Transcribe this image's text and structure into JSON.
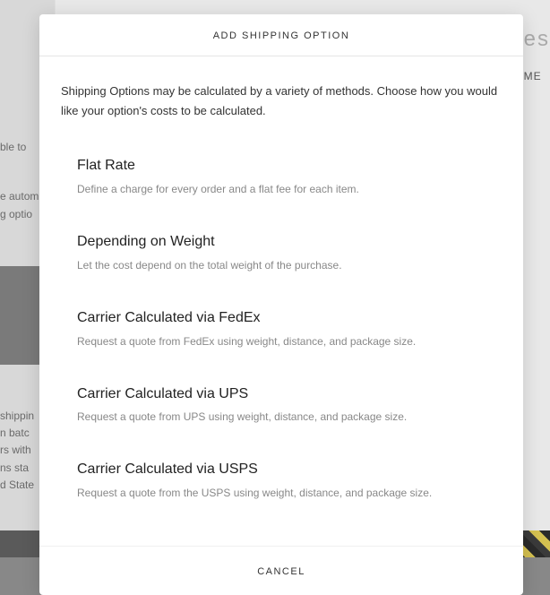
{
  "modal": {
    "title": "ADD SHIPPING OPTION",
    "intro": "Shipping Options may be calculated by a variety of methods. Choose how you would like your option's costs to be calculated.",
    "options": [
      {
        "title": "Flat Rate",
        "desc": "Define a charge for every order and a flat fee for each item."
      },
      {
        "title": "Depending on Weight",
        "desc": "Let the cost depend on the total weight of the purchase."
      },
      {
        "title": "Carrier Calculated via FedEx",
        "desc": "Request a quote from FedEx using weight, distance, and package size."
      },
      {
        "title": "Carrier Calculated via UPS",
        "desc": "Request a quote from UPS using weight, distance, and package size."
      },
      {
        "title": "Carrier Calculated via USPS",
        "desc": "Request a quote from the USPS using weight, distance, and package size."
      }
    ],
    "cancel": "CANCEL"
  },
  "backdrop": {
    "t1": "ble to",
    "t2": "e autom",
    "t3": "g optio",
    "t4": "shippin\nn batc\nrs with\nns sta\nd State",
    "right": "es",
    "right2": "ME"
  }
}
